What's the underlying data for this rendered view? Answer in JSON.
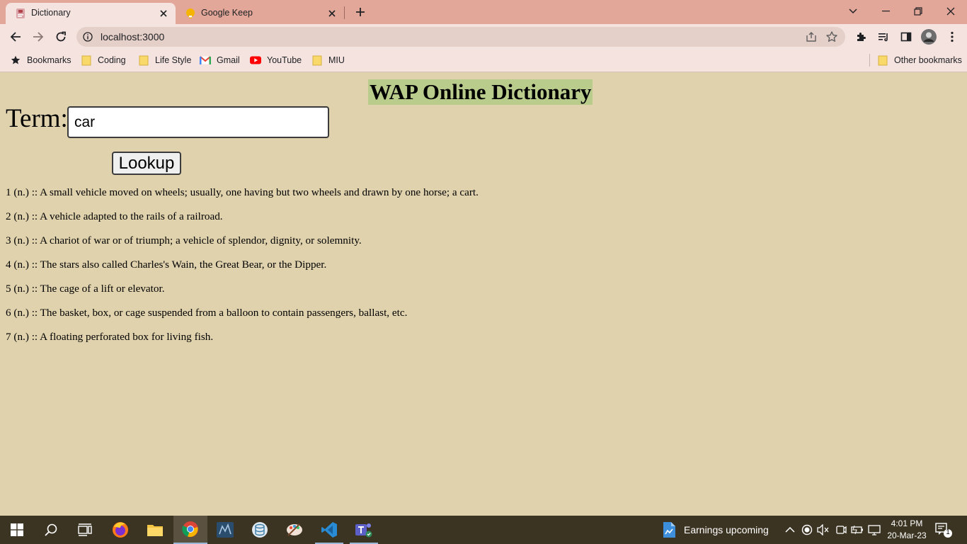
{
  "browser": {
    "tabs": [
      {
        "title": "Dictionary",
        "active": true
      },
      {
        "title": "Google Keep",
        "active": false
      }
    ],
    "url": "localhost:3000",
    "bookmarks": [
      {
        "label": "Bookmarks",
        "icon": "star-icon"
      },
      {
        "label": "Coding",
        "icon": "folder-icon"
      },
      {
        "label": "Life Style",
        "icon": "folder-icon"
      },
      {
        "label": "Gmail",
        "icon": "gmail-icon"
      },
      {
        "label": "YouTube",
        "icon": "youtube-icon"
      },
      {
        "label": "MIU",
        "icon": "folder-icon"
      }
    ],
    "other_bookmarks": "Other bookmarks"
  },
  "page": {
    "title": "WAP Online Dictionary",
    "term_label": "Term:",
    "term_value": "car",
    "lookup_label": "Lookup",
    "definitions": [
      "1 (n.) :: A small vehicle moved on wheels; usually, one having but two wheels and drawn by one horse; a cart.",
      "2 (n.) :: A vehicle adapted to the rails of a railroad.",
      "3 (n.) :: A chariot of war or of triumph; a vehicle of splendor, dignity, or solemnity.",
      "4 (n.) :: The stars also called Charles's Wain, the Great Bear, or the Dipper.",
      "5 (n.) :: The cage of a lift or elevator.",
      "6 (n.) :: The basket, box, or cage suspended from a balloon to contain passengers, ballast, etc.",
      "7 (n.) :: A floating perforated box for living fish."
    ]
  },
  "taskbar": {
    "news": "Earnings upcoming",
    "time": "4:01 PM",
    "date": "20-Mar-23",
    "notification_count": "1"
  },
  "colors": {
    "page_background": "#e0d2ad",
    "title_highlight": "#b9cc8b",
    "tab_strip": "#e2a799",
    "toolbar": "#f4e3df",
    "taskbar": "#3c3422"
  }
}
